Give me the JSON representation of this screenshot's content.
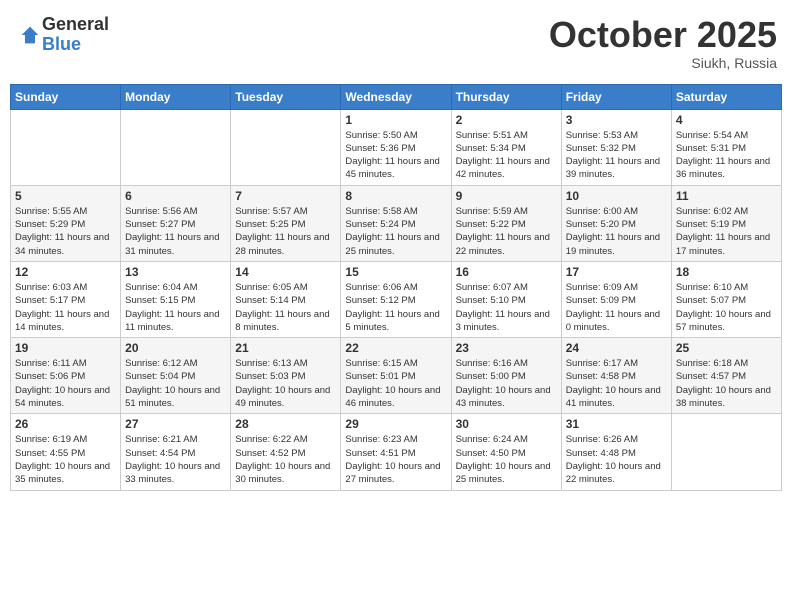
{
  "header": {
    "logo_general": "General",
    "logo_blue": "Blue",
    "month": "October 2025",
    "location": "Siukh, Russia"
  },
  "days_of_week": [
    "Sunday",
    "Monday",
    "Tuesday",
    "Wednesday",
    "Thursday",
    "Friday",
    "Saturday"
  ],
  "weeks": [
    [
      {
        "day": "",
        "info": ""
      },
      {
        "day": "",
        "info": ""
      },
      {
        "day": "",
        "info": ""
      },
      {
        "day": "1",
        "info": "Sunrise: 5:50 AM\nSunset: 5:36 PM\nDaylight: 11 hours and 45 minutes."
      },
      {
        "day": "2",
        "info": "Sunrise: 5:51 AM\nSunset: 5:34 PM\nDaylight: 11 hours and 42 minutes."
      },
      {
        "day": "3",
        "info": "Sunrise: 5:53 AM\nSunset: 5:32 PM\nDaylight: 11 hours and 39 minutes."
      },
      {
        "day": "4",
        "info": "Sunrise: 5:54 AM\nSunset: 5:31 PM\nDaylight: 11 hours and 36 minutes."
      }
    ],
    [
      {
        "day": "5",
        "info": "Sunrise: 5:55 AM\nSunset: 5:29 PM\nDaylight: 11 hours and 34 minutes."
      },
      {
        "day": "6",
        "info": "Sunrise: 5:56 AM\nSunset: 5:27 PM\nDaylight: 11 hours and 31 minutes."
      },
      {
        "day": "7",
        "info": "Sunrise: 5:57 AM\nSunset: 5:25 PM\nDaylight: 11 hours and 28 minutes."
      },
      {
        "day": "8",
        "info": "Sunrise: 5:58 AM\nSunset: 5:24 PM\nDaylight: 11 hours and 25 minutes."
      },
      {
        "day": "9",
        "info": "Sunrise: 5:59 AM\nSunset: 5:22 PM\nDaylight: 11 hours and 22 minutes."
      },
      {
        "day": "10",
        "info": "Sunrise: 6:00 AM\nSunset: 5:20 PM\nDaylight: 11 hours and 19 minutes."
      },
      {
        "day": "11",
        "info": "Sunrise: 6:02 AM\nSunset: 5:19 PM\nDaylight: 11 hours and 17 minutes."
      }
    ],
    [
      {
        "day": "12",
        "info": "Sunrise: 6:03 AM\nSunset: 5:17 PM\nDaylight: 11 hours and 14 minutes."
      },
      {
        "day": "13",
        "info": "Sunrise: 6:04 AM\nSunset: 5:15 PM\nDaylight: 11 hours and 11 minutes."
      },
      {
        "day": "14",
        "info": "Sunrise: 6:05 AM\nSunset: 5:14 PM\nDaylight: 11 hours and 8 minutes."
      },
      {
        "day": "15",
        "info": "Sunrise: 6:06 AM\nSunset: 5:12 PM\nDaylight: 11 hours and 5 minutes."
      },
      {
        "day": "16",
        "info": "Sunrise: 6:07 AM\nSunset: 5:10 PM\nDaylight: 11 hours and 3 minutes."
      },
      {
        "day": "17",
        "info": "Sunrise: 6:09 AM\nSunset: 5:09 PM\nDaylight: 11 hours and 0 minutes."
      },
      {
        "day": "18",
        "info": "Sunrise: 6:10 AM\nSunset: 5:07 PM\nDaylight: 10 hours and 57 minutes."
      }
    ],
    [
      {
        "day": "19",
        "info": "Sunrise: 6:11 AM\nSunset: 5:06 PM\nDaylight: 10 hours and 54 minutes."
      },
      {
        "day": "20",
        "info": "Sunrise: 6:12 AM\nSunset: 5:04 PM\nDaylight: 10 hours and 51 minutes."
      },
      {
        "day": "21",
        "info": "Sunrise: 6:13 AM\nSunset: 5:03 PM\nDaylight: 10 hours and 49 minutes."
      },
      {
        "day": "22",
        "info": "Sunrise: 6:15 AM\nSunset: 5:01 PM\nDaylight: 10 hours and 46 minutes."
      },
      {
        "day": "23",
        "info": "Sunrise: 6:16 AM\nSunset: 5:00 PM\nDaylight: 10 hours and 43 minutes."
      },
      {
        "day": "24",
        "info": "Sunrise: 6:17 AM\nSunset: 4:58 PM\nDaylight: 10 hours and 41 minutes."
      },
      {
        "day": "25",
        "info": "Sunrise: 6:18 AM\nSunset: 4:57 PM\nDaylight: 10 hours and 38 minutes."
      }
    ],
    [
      {
        "day": "26",
        "info": "Sunrise: 6:19 AM\nSunset: 4:55 PM\nDaylight: 10 hours and 35 minutes."
      },
      {
        "day": "27",
        "info": "Sunrise: 6:21 AM\nSunset: 4:54 PM\nDaylight: 10 hours and 33 minutes."
      },
      {
        "day": "28",
        "info": "Sunrise: 6:22 AM\nSunset: 4:52 PM\nDaylight: 10 hours and 30 minutes."
      },
      {
        "day": "29",
        "info": "Sunrise: 6:23 AM\nSunset: 4:51 PM\nDaylight: 10 hours and 27 minutes."
      },
      {
        "day": "30",
        "info": "Sunrise: 6:24 AM\nSunset: 4:50 PM\nDaylight: 10 hours and 25 minutes."
      },
      {
        "day": "31",
        "info": "Sunrise: 6:26 AM\nSunset: 4:48 PM\nDaylight: 10 hours and 22 minutes."
      },
      {
        "day": "",
        "info": ""
      }
    ]
  ]
}
